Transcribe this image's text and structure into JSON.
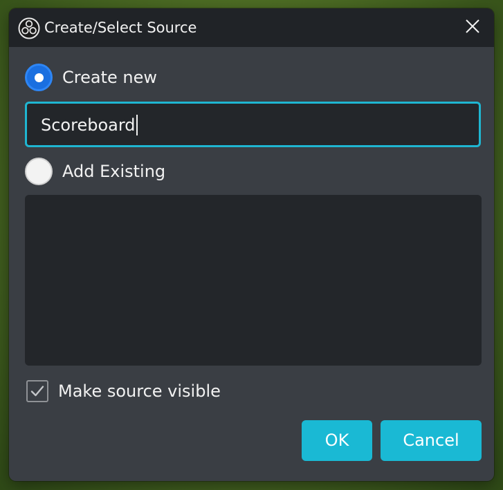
{
  "dialog": {
    "title": "Create/Select Source",
    "app_icon": "obs-logo-icon",
    "close_icon": "close-icon"
  },
  "create_new": {
    "label": "Create new",
    "selected": true
  },
  "source_name": {
    "value": "Scoreboard",
    "focused": true
  },
  "add_existing": {
    "label": "Add Existing",
    "selected": false,
    "items": []
  },
  "make_visible": {
    "label": "Make source visible",
    "checked": true
  },
  "buttons": {
    "ok_label": "OK",
    "cancel_label": "Cancel"
  },
  "colors": {
    "accent": "#1ab9d4",
    "radio_selected": "#1a6fe0",
    "dialog_bg": "#3a3e44",
    "titlebar_bg": "#202327",
    "field_bg": "#23262a"
  }
}
